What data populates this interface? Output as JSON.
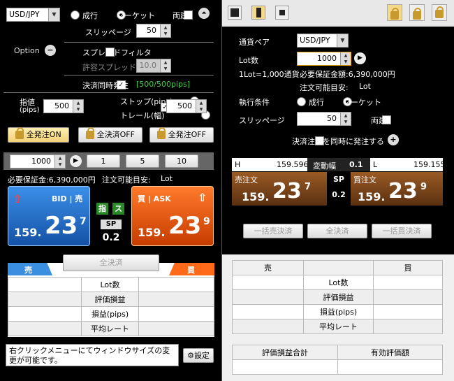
{
  "left": {
    "pair": "USD/JPY",
    "exec_limit": "成行",
    "exec_market": "マーケット",
    "ryodate": "両建",
    "slip_label": "スリッページ",
    "slip_value": "50",
    "option_label": "Option",
    "spread_filter": "スプレッドフィルタ",
    "allow_spread_label": "許容スプレッド",
    "allow_spread_value": "10.0",
    "close_simul": "決済同時発注",
    "close_simul_info": "[500/500pips]",
    "limit_label": "指値",
    "limit_unit": "(pips)",
    "limit_value": "500",
    "stop_label": "ストップ(pips)",
    "trail_label": "トレール(幅)",
    "stop_value": "500",
    "btn_all_on": "全発注ON",
    "btn_close_off": "全決済OFF",
    "btn_all_off": "全発注OFF",
    "lot_value": "1000",
    "quick_lots": [
      "1",
      "5",
      "10"
    ],
    "margin": "必要保証金:6,390,000円",
    "possible": "注文可能目安:",
    "possible_val": "Lot",
    "bid_label": "BID | 売",
    "bid_big": "159.",
    "bid_mid": "23",
    "bid_sup": "7",
    "ask_label": "買 | ASK",
    "ask_big": "159.",
    "ask_mid": "23",
    "ask_sup": "9",
    "tag_sashi": "指",
    "tag_su": "ス",
    "sp_label": "SP",
    "sp_value": "0.2",
    "close_all": "全決済",
    "sell_tab": "売",
    "buy_tab": "買",
    "rows": [
      "Lot数",
      "評価損益",
      "損益(pips)",
      "平均レート"
    ],
    "footer_msg": "右クリックメニューにてウィンドウサイズの変更が可能です。",
    "settings": "設定"
  },
  "right": {
    "pair_label": "通貨ペア",
    "pair": "USD/JPY",
    "lot_label": "Lot数",
    "lot_value": "1000",
    "lot_note": "1Lot=1,000通貨",
    "margin": "必要保証金額:6,390,000円",
    "possible": "注文可能目安:",
    "possible_val": "Lot",
    "exec_label": "執行条件",
    "exec_limit": "成行",
    "exec_market": "マーケット",
    "slip_label": "スリッページ",
    "slip_value": "50",
    "ryodate": "両建",
    "simul": "決済注文を同時に発注する",
    "high_label": "H",
    "high_value": "159.596",
    "range_label": "変動幅",
    "range_value": "0.1",
    "low_label": "L",
    "low_value": "159.155",
    "sell_label": "売注文",
    "sell_big": "159.",
    "sell_mid": "23",
    "sell_sup": "7",
    "buy_label": "買注文",
    "buy_big": "159.",
    "buy_mid": "23",
    "buy_sup": "9",
    "sp_label": "SP",
    "sp_value": "0.2",
    "btn_sell_all": "一括売決済",
    "btn_close_all": "全決済",
    "btn_buy_all": "一括買決済",
    "sell_head": "売",
    "buy_head": "買",
    "rows": [
      "Lot数",
      "評価損益",
      "損益(pips)",
      "平均レート"
    ],
    "sum_head": "評価損益合計",
    "eq_head": "有効評価額"
  }
}
